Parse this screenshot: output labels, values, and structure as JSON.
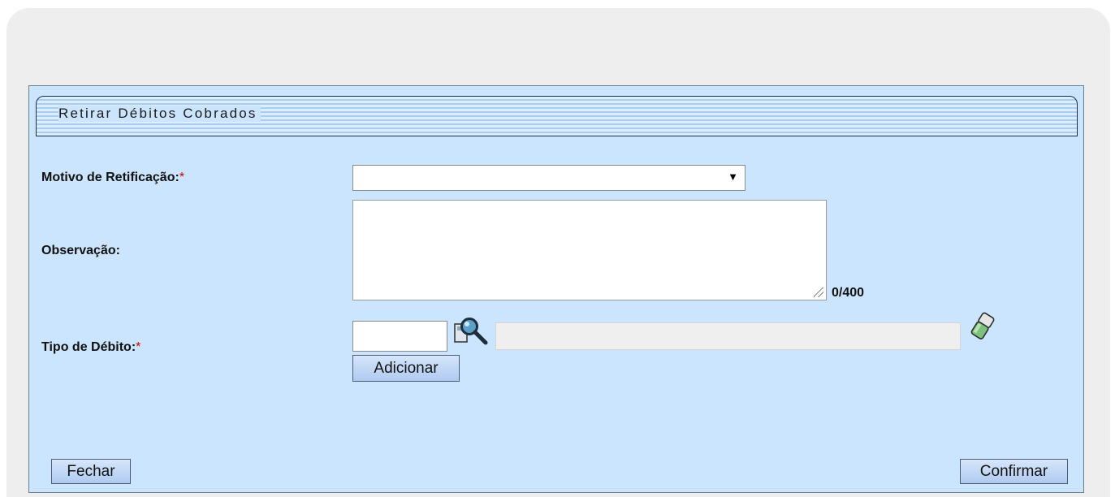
{
  "panel": {
    "title": "Retirar Débitos Cobrados"
  },
  "form": {
    "motivo": {
      "label": "Motivo de Retificação:",
      "required_mark": "*",
      "selected_value": ""
    },
    "observacao": {
      "label": "Observação:",
      "value": "",
      "counter": "0/400"
    },
    "tipo_debito": {
      "label": "Tipo de Débito:",
      "required_mark": "*",
      "code_value": "",
      "description_value": "",
      "add_label": "Adicionar"
    }
  },
  "footer": {
    "close_label": "Fechar",
    "confirm_label": "Confirmar"
  },
  "icons": {
    "search": "magnifier-icon",
    "clear": "eraser-icon"
  }
}
